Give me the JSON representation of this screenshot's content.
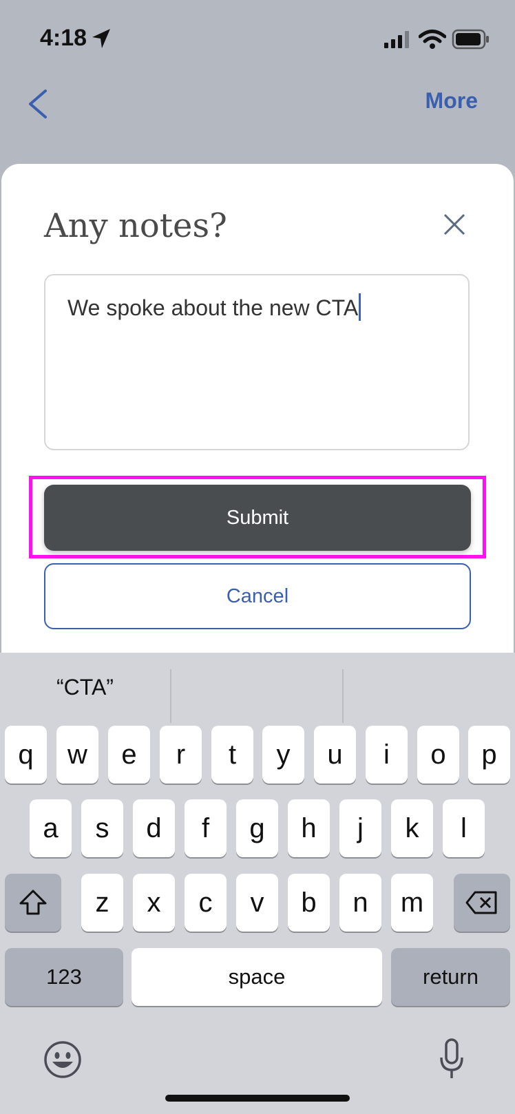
{
  "status_bar": {
    "time": "4:18",
    "icons": [
      "location-arrow-icon",
      "signal-icon",
      "wifi-icon",
      "battery-icon"
    ]
  },
  "nav": {
    "back_icon": "chevron-left-icon",
    "more_label": "More"
  },
  "modal": {
    "title": "Any notes?",
    "close_icon": "close-icon",
    "notes_value": "We spoke about the new CTA",
    "submit_label": "Submit",
    "cancel_label": "Cancel"
  },
  "keyboard": {
    "suggestions": [
      "“CTA”",
      "",
      ""
    ],
    "row1": [
      "q",
      "w",
      "e",
      "r",
      "t",
      "y",
      "u",
      "i",
      "o",
      "p"
    ],
    "row2": [
      "a",
      "s",
      "d",
      "f",
      "g",
      "h",
      "j",
      "k",
      "l"
    ],
    "row3": [
      "z",
      "x",
      "c",
      "v",
      "b",
      "n",
      "m"
    ],
    "numbers_label": "123",
    "space_label": "space",
    "return_label": "return"
  },
  "colors": {
    "accent": "#3a5fae",
    "submit_bg": "#4a4d50",
    "highlight": "#ff10f0"
  }
}
